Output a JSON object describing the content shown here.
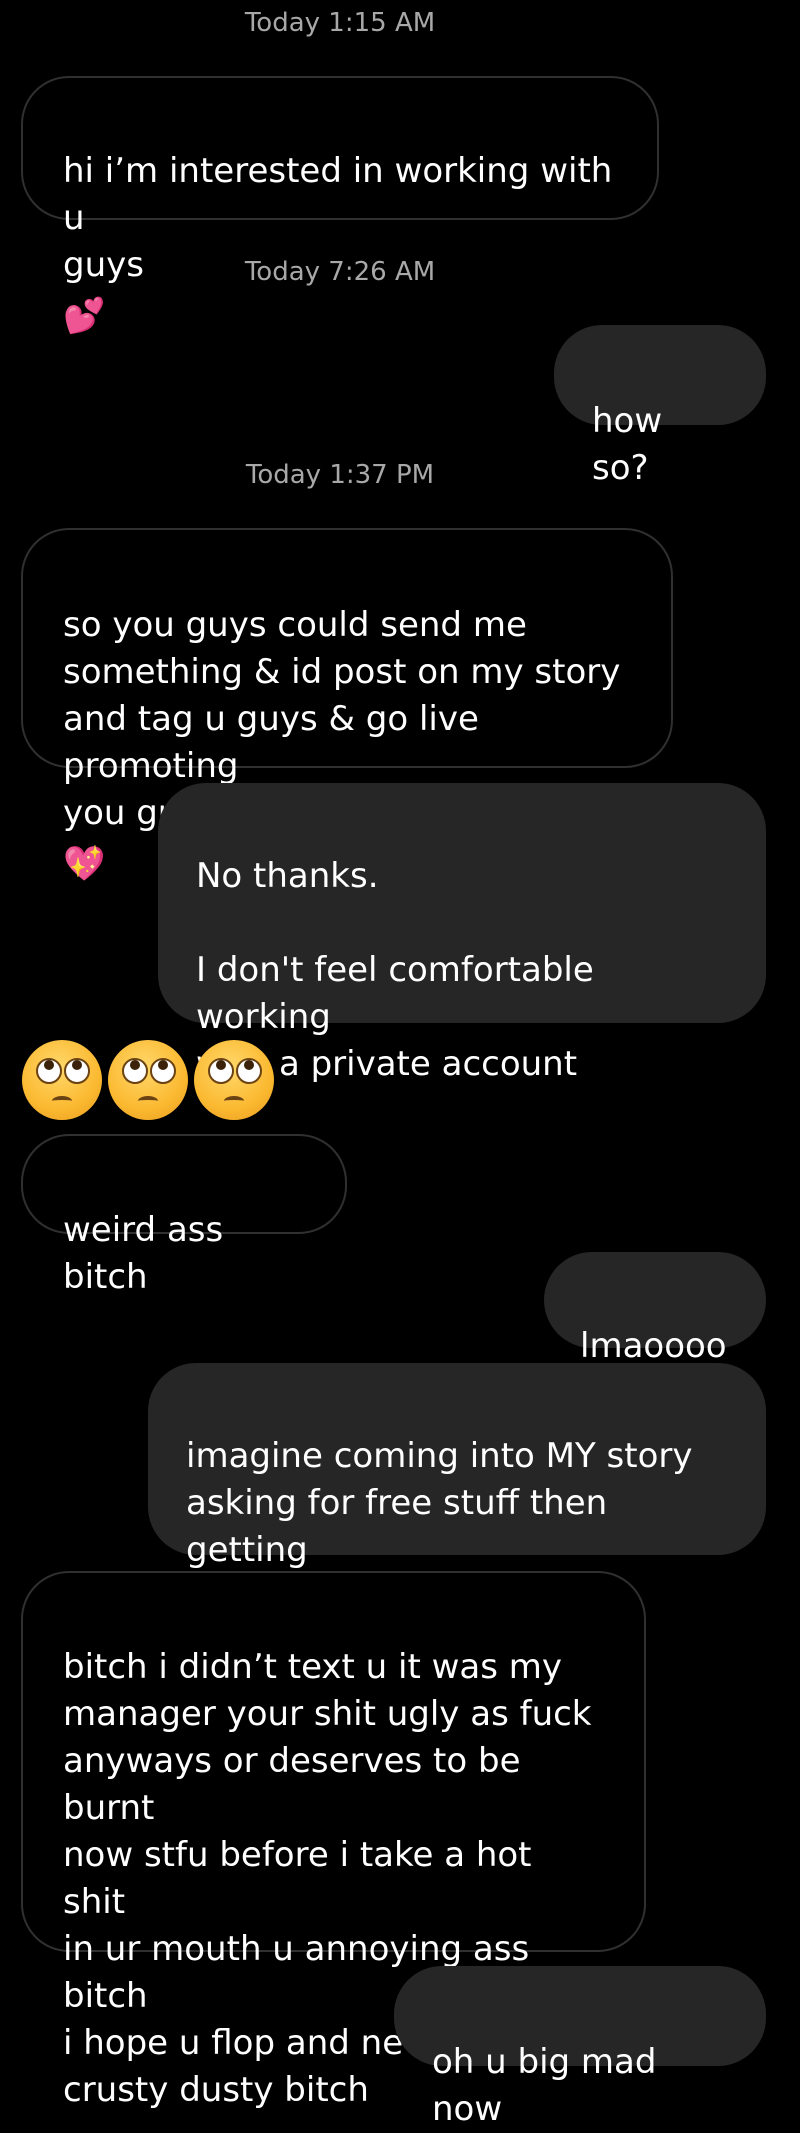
{
  "timestamps": [
    "Today 1:15 AM",
    "Today 7:26 AM",
    "Today 1:37 PM"
  ],
  "messages": [
    {
      "text": "hi i’m interested in working with u\nguys",
      "emoji": "💕"
    },
    {
      "text": "how so?"
    },
    {
      "text": "so you guys could send me\nsomething & id post on my story\nand tag u guys & go live promoting\nyou guys",
      "emoji": "💖"
    },
    {
      "text": "No thanks.\n\nI don't feel comfortable working\nwith a private account"
    },
    {
      "emoji_reaction": "🙄🙄🙄"
    },
    {
      "text": "weird ass bitch"
    },
    {
      "text": "lmaoooo"
    },
    {
      "text": "imagine coming into MY story\nasking for free stuff then getting\nupset cause I said no",
      "emoji": "🥴"
    },
    {
      "text": "bitch i didn’t text u it was my\nmanager your shit ugly as fuck\nanyways or deserves to be burnt\nnow stfu before i take a hot shit\nin ur mouth u annoying ass bitch\ni hope u flop and never sell shit\ncrusty dusty bitch"
    },
    {
      "text": "oh u big mad now"
    }
  ]
}
